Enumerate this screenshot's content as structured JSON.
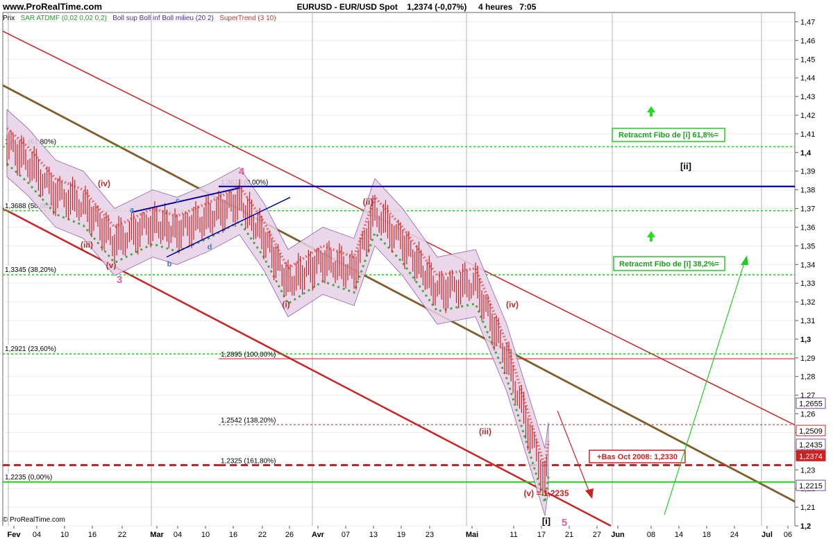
{
  "header": {
    "site": "www.ProRealTime.com",
    "instrument": "EURUSD - EUR/USD Spot",
    "quote": "1,2374 (-0,07%)",
    "timeframe": "4 heures",
    "time": "7:05"
  },
  "indicators": {
    "prix": "Prix",
    "sar": "SAR ATDMF (0,02 0,02 0,2)",
    "boll": "Boll sup Boll inf Boll milieu (20 2)",
    "supertrend": "SuperTrend (3 10)"
  },
  "copyright": "© ProRealTime.com",
  "colors": {
    "grid": "#b4b4b4",
    "price": "#cc2222",
    "boll_fill": "#e7d2e7",
    "boll_line": "#7a4a9a",
    "sar": "#e07070",
    "supertrend_up": "#44aa44",
    "channel": "#cc2222",
    "channel_mid": "#5a8a3a",
    "fibo": "#22cc22",
    "navy": "#0000a0",
    "wave_label": "#b03030",
    "wave_big": "#e060a0"
  },
  "chart_data": {
    "type": "candlestick",
    "ylim": [
      1.2,
      1.475
    ],
    "y_ticks": [
      "1,47",
      "1,46",
      "1,45",
      "1,44",
      "1,43",
      "1,42",
      "1,41",
      "1,4",
      "1,39",
      "1,38",
      "1,37",
      "1,36",
      "1,35",
      "1,34",
      "1,33",
      "1,32",
      "1,31",
      "1,3",
      "1,29",
      "1,28",
      "1,27",
      "1,26",
      "1,25",
      "1,24",
      "1,23",
      "1,22",
      "1,21",
      "1,2"
    ],
    "x_ticks": [
      "Fev",
      "04",
      "10",
      "16",
      "22",
      "Mar",
      "04",
      "10",
      "16",
      "22",
      "26",
      "Avr",
      "07",
      "13",
      "19",
      "23",
      "Mai",
      "11",
      "17",
      "21",
      "27",
      "Jun",
      "08",
      "14",
      "18",
      "24",
      "Jul",
      "06"
    ],
    "price_path": [
      [
        "Fev",
        1.405
      ],
      [
        "04",
        1.395
      ],
      [
        "10",
        1.378
      ],
      [
        "16",
        1.372
      ],
      [
        "22",
        1.352
      ],
      [
        "Mar",
        1.362
      ],
      [
        "04",
        1.358
      ],
      [
        "10",
        1.365
      ],
      [
        "16",
        1.374
      ],
      [
        "22",
        1.355
      ],
      [
        "26",
        1.33
      ],
      [
        "Avr",
        1.342
      ],
      [
        "07",
        1.336
      ],
      [
        "13",
        1.368
      ],
      [
        "19",
        1.352
      ],
      [
        "23",
        1.326
      ],
      [
        "Mai",
        1.33
      ],
      [
        "11",
        1.29
      ],
      [
        "17",
        1.2235
      ],
      [
        "17",
        1.2374
      ]
    ],
    "fibo_levels": [
      {
        "label": "1,4031 (61,80%)",
        "value": 1.4031
      },
      {
        "label": "1,3688 (50,00%)",
        "value": 1.3688
      },
      {
        "label": "1,3345 (38,20%)",
        "value": 1.3345
      },
      {
        "label": "1,2921 (23,60%)",
        "value": 1.2921
      },
      {
        "label": "1,2235 (0,00%)",
        "value": 1.2235
      }
    ],
    "fibo_ext_levels": [
      {
        "label": "1,3818 (0,00%)",
        "value": 1.3818
      },
      {
        "label": "1,2895 (100,00%)",
        "value": 1.2895
      },
      {
        "label": "1,2542 (138,20%)",
        "value": 1.2542
      },
      {
        "label": "1,2325 (161,80%)",
        "value": 1.2325
      }
    ],
    "right_axis_tags": [
      {
        "label": "1,2655",
        "value": 1.2655,
        "color": "#7a4a9a"
      },
      {
        "label": "1,2509",
        "value": 1.2509,
        "color": "#cc2222"
      },
      {
        "label": "1,2435",
        "value": 1.2435,
        "color": "#7a4a9a"
      },
      {
        "label": "1,2374",
        "value": 1.2374,
        "color": "#cc2222"
      },
      {
        "label": "1,2215",
        "value": 1.2215,
        "color": "#7a4a9a"
      }
    ],
    "wave_labels_small": [
      "(iv)",
      "(iii)",
      "(v)",
      "(ii)",
      "(i)",
      "(iv)",
      "(iii)"
    ],
    "wave_labels_large": [
      "3",
      "4",
      "5"
    ],
    "wave_labels_letters": [
      "a",
      "b",
      "c",
      "d"
    ],
    "wave_label_v": "(v) = 1,2235",
    "wave_label_i": "[i]",
    "wave_label_ii": "[ii]",
    "annotations": [
      "Retracmt Fibo de [i] 61,8%=",
      "Retracmt Fibo de [i] 38,2%=",
      "+Bas Oct 2008: 1,2330"
    ]
  }
}
